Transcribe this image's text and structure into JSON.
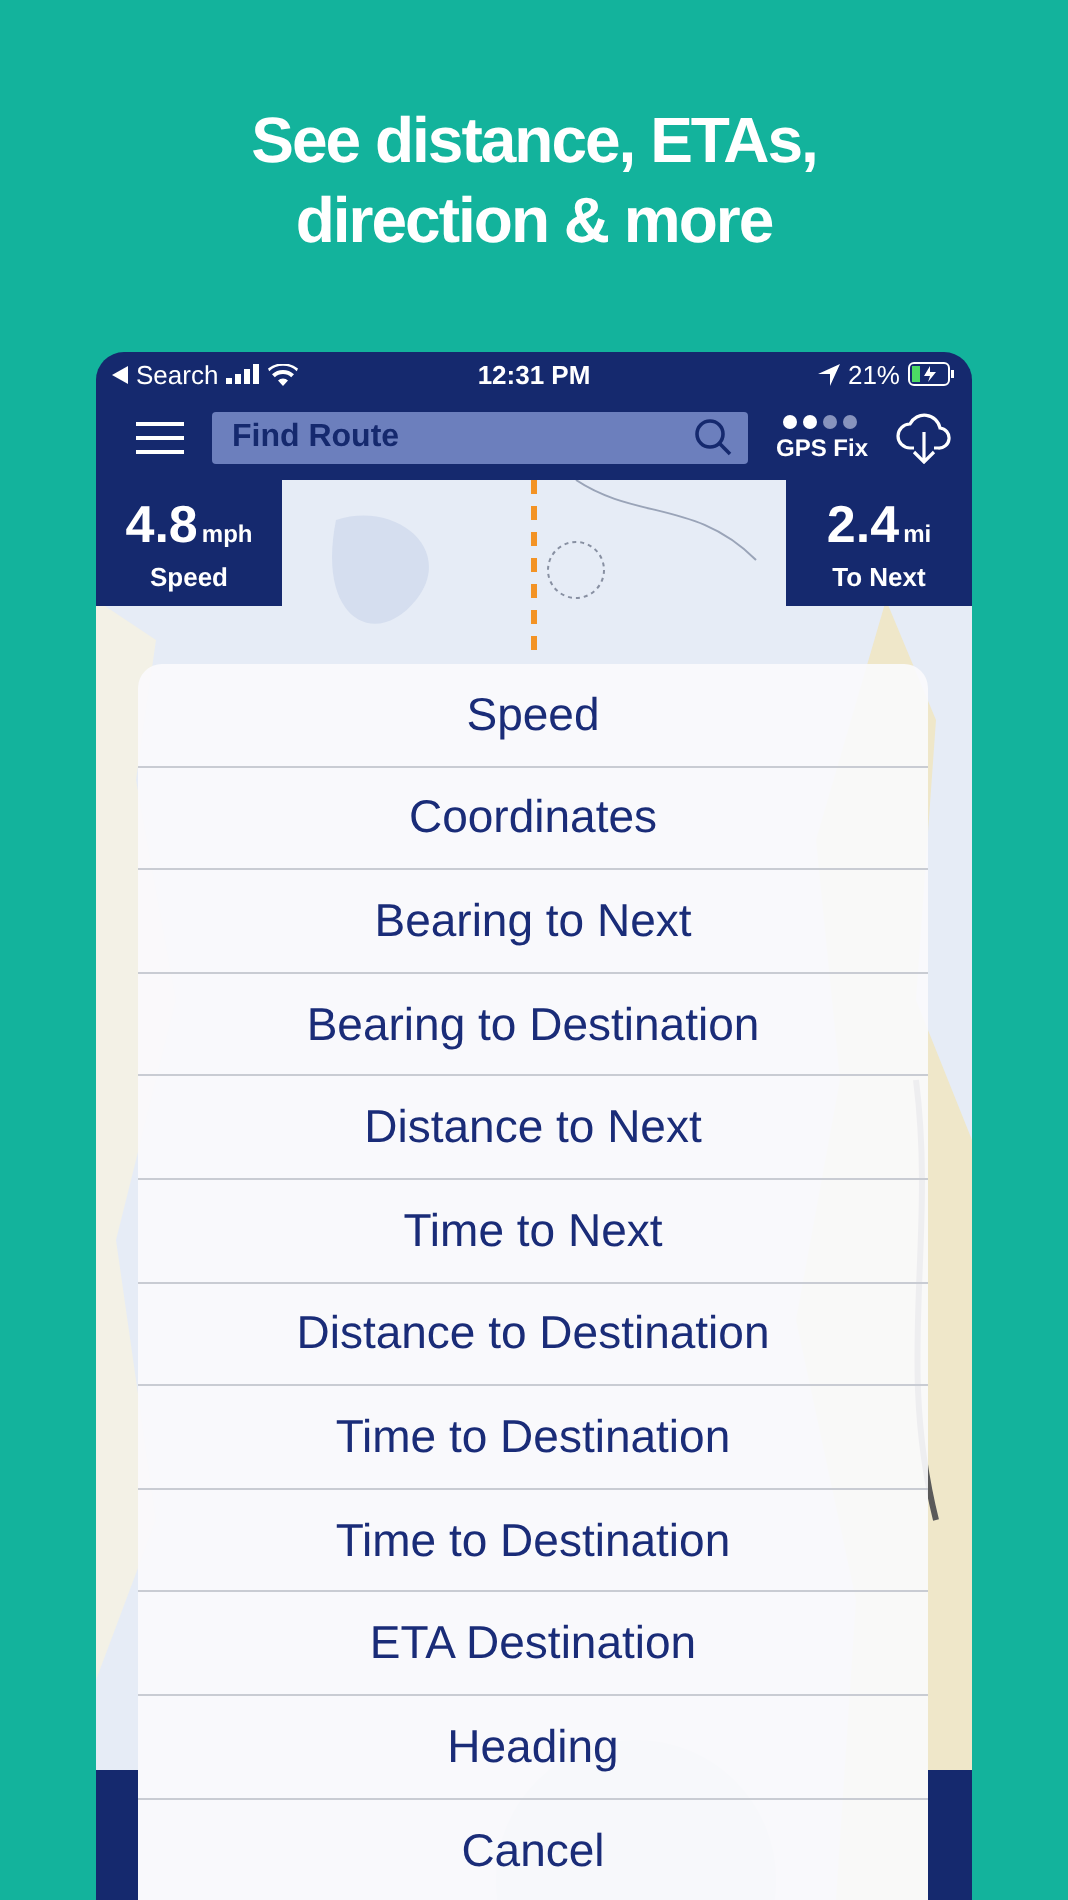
{
  "headline": "See distance, ETAs, direction & more",
  "status_bar": {
    "back": "Search",
    "time": "12:31 PM",
    "battery": "21%"
  },
  "nav_bar": {
    "search": {
      "placeholder": "Find Route"
    },
    "gps": "GPS Fix"
  },
  "tiles": [
    {
      "value": "4.8",
      "unit": "mph",
      "label": "Speed"
    },
    {
      "value": "2.4",
      "unit": "mi",
      "label": "To Next"
    }
  ],
  "menu": {
    "items": [
      "Speed",
      "Coordinates",
      "Bearing to Next",
      "Bearing to Destination",
      "Distance to Next",
      "Time to Next",
      "Distance to Destination",
      "Time to Destination",
      "Time to Destination",
      "ETA Destination",
      "Heading"
    ],
    "cancel": "Cancel"
  }
}
